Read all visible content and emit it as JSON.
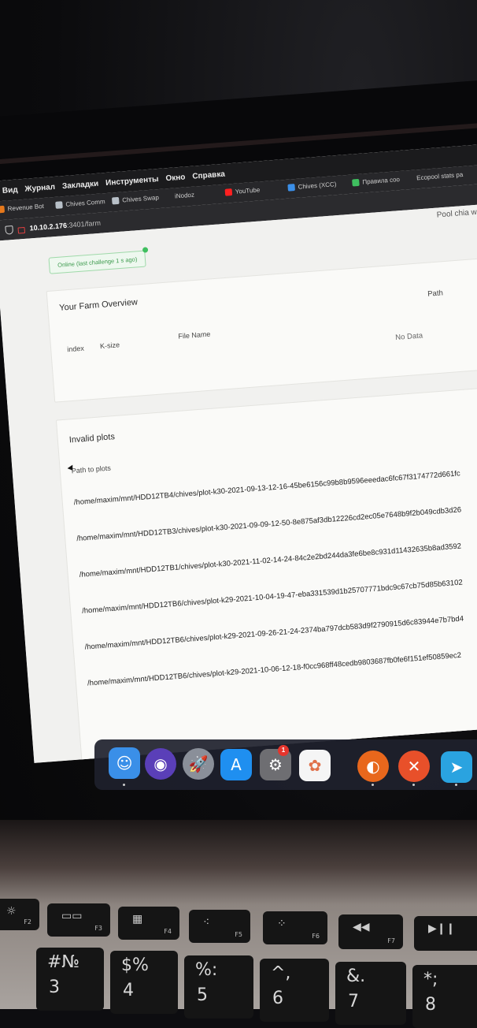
{
  "menubar": [
    "Вид",
    "Журнал",
    "Закладки",
    "Инструменты",
    "Окно",
    "Справка"
  ],
  "bookmarks": [
    {
      "label": "Revenue Bot",
      "color": "#e6791c"
    },
    {
      "label": "Chives Comm",
      "color": "#b8c0c8"
    },
    {
      "label": "Chives Swap",
      "color": "#b8c0c8"
    },
    {
      "label": "iNodoz",
      "color": ""
    },
    {
      "label": "YouTube",
      "color": "#ff2020"
    },
    {
      "label": "Chives (XCC)",
      "color": "#3b8fe8"
    },
    {
      "label": "Правила coo",
      "color": "#3fbf5f"
    },
    {
      "label": "Ecopool stats pa",
      "color": ""
    }
  ],
  "url": {
    "host": "10.10.2.176",
    "path": ":3401/farm"
  },
  "tab_pool": "Pool chia wa",
  "status": {
    "badge": "Online (last challenge 1 s ago)"
  },
  "farm": {
    "title": "Your Farm Overview",
    "headers": {
      "index": "index",
      "ksize": "K-size",
      "file": "File Name",
      "path": "Path"
    },
    "empty": "No Data"
  },
  "invalid": {
    "title": "Invalid plots",
    "header": "Path to plots",
    "rows": [
      "/home/maxim/mnt/HDD12TB4/chives/plot-k30-2021-09-13-12-16-45be6156c99b8b9596eeedac6fc67f3174772d661fc",
      "/home/maxim/mnt/HDD12TB3/chives/plot-k30-2021-09-09-12-50-8e875af3db12226cd2ec05e7648b9f2b049cdb3d26",
      "/home/maxim/mnt/HDD12TB1/chives/plot-k30-2021-11-02-14-24-84c2e2bd244da3fe6be8c931d11432635b8ad3592",
      "/home/maxim/mnt/HDD12TB6/chives/plot-k29-2021-10-04-19-47-eba331539d1b25707771bdc9c67cb75d85b63102",
      "/home/maxim/mnt/HDD12TB6/chives/plot-k29-2021-09-26-21-24-2374ba797dcb583d9f2790915d6c83944e7b7bd4",
      "/home/maxim/mnt/HDD12TB6/chives/plot-k29-2021-10-06-12-18-f0cc968ff48cedb9803687fb0fe6f151ef50859ec2"
    ]
  },
  "dock": {
    "apps": [
      {
        "name": "finder-icon",
        "glyph": "☺",
        "color": "#3a8fe8",
        "running": true
      },
      {
        "name": "siri-icon",
        "glyph": "◉",
        "color": "#5a3fb8",
        "running": false
      },
      {
        "name": "launchpad-icon",
        "glyph": "🚀",
        "color": "#8a8f99",
        "running": false
      },
      {
        "name": "app-store-icon",
        "glyph": "A",
        "color": "#1f8ff0",
        "running": false
      },
      {
        "name": "system-preferences-icon",
        "glyph": "⚙",
        "color": "#6e6e72",
        "running": false
      },
      {
        "name": "photos-icon",
        "glyph": "✿",
        "color": "#f5f5f5",
        "running": false
      },
      {
        "name": "firefox-icon",
        "glyph": "◐",
        "color": "#e8671c",
        "running": true
      },
      {
        "name": "anydesk-icon",
        "glyph": "✕",
        "color": "#e8502a",
        "running": true
      },
      {
        "name": "telegram-icon",
        "glyph": "➤",
        "color": "#2aa3e0",
        "running": true
      }
    ],
    "badge": "1"
  },
  "keyboard": {
    "frow": [
      "F2",
      "F3",
      "F4",
      "F5",
      "F6",
      "F7"
    ],
    "keys": [
      {
        "sym": "#№",
        "num": "3"
      },
      {
        "sym": "$%",
        "num": "4"
      },
      {
        "sym": "%:",
        "num": "5"
      },
      {
        "sym": "^,",
        "num": "6"
      },
      {
        "sym": "&.",
        "num": "7"
      },
      {
        "sym": "*;",
        "num": "8"
      }
    ]
  }
}
